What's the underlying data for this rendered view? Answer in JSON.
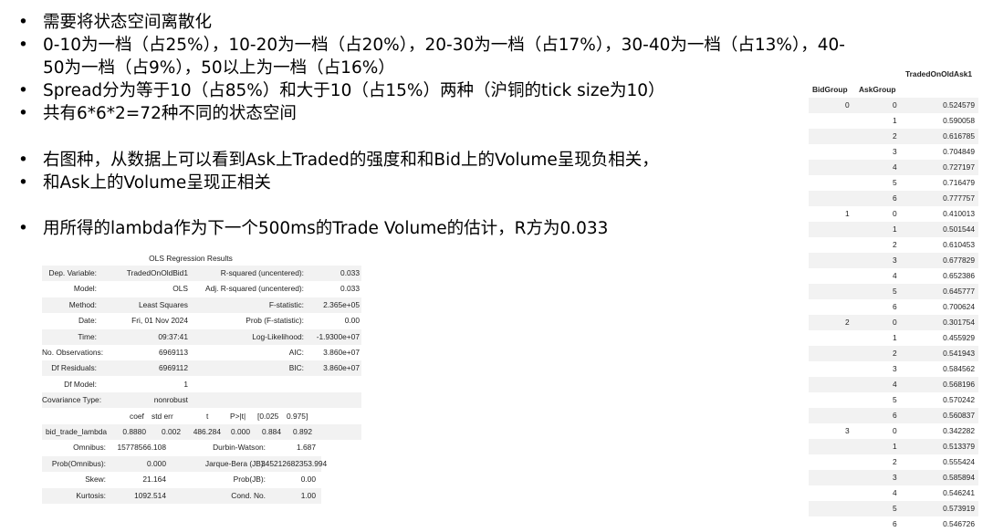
{
  "bullets": [
    {
      "text": "需要将状态空间离散化"
    },
    {
      "text": "0-10为一档（占25%），10-20为一档（占20%），20-30为一档（占17%），30-40为一档（占13%），40-",
      "cont": "50为一档（占9%），50以上为一档（占16%）"
    },
    {
      "text": "Spread分为等于10（占85%）和大于10（占15%）两种（沪铜的tick size为10）"
    },
    {
      "text": "共有6*6*2=72种不同的状态空间"
    },
    {
      "text": "右图种，从数据上可以看到Ask上Traded的强度和和Bid上的Volume呈现负相关，"
    },
    {
      "text": "和Ask上的Volume呈现正相关"
    },
    {
      "text": "用所得的lambda作为下一个500ms的Trade Volume的估计，R方为0.033"
    }
  ],
  "bullet_symbol": "•",
  "ols": {
    "caption": "OLS Regression Results",
    "summary": [
      [
        "Dep. Variable:",
        "TradedOnOldBid1",
        "R-squared (uncentered):",
        "0.033"
      ],
      [
        "Model:",
        "OLS",
        "Adj. R-squared (uncentered):",
        "0.033"
      ],
      [
        "Method:",
        "Least Squares",
        "F-statistic:",
        "2.365e+05"
      ],
      [
        "Date:",
        "Fri, 01 Nov 2024",
        "Prob (F-statistic):",
        "0.00"
      ],
      [
        "Time:",
        "09:37:41",
        "Log-Likelihood:",
        "-1.9300e+07"
      ],
      [
        "No. Observations:",
        "6969113",
        "AIC:",
        "3.860e+07"
      ],
      [
        "Df Residuals:",
        "6969112",
        "BIC:",
        "3.860e+07"
      ],
      [
        "Df Model:",
        "1",
        "",
        ""
      ],
      [
        "Covariance Type:",
        "nonrobust",
        "",
        ""
      ]
    ],
    "coef_header": [
      "coef",
      "std err",
      "t",
      "P>|t|",
      "[0.025",
      "0.975]"
    ],
    "coef_row": [
      "bid_trade_lambda",
      "0.8880",
      "0.002",
      "486.284",
      "0.000",
      "0.884",
      "0.892"
    ],
    "diag": [
      [
        "Omnibus:",
        "15778566.108",
        "Durbin-Watson:",
        "1.687"
      ],
      [
        "Prob(Omnibus):",
        "0.000",
        "Jarque-Bera (JB):",
        "345212682353.994"
      ],
      [
        "Skew:",
        "21.164",
        "Prob(JB):",
        "0.00"
      ],
      [
        "Kurtosis:",
        "1092.514",
        "Cond. No.",
        "1.00"
      ]
    ]
  },
  "grouped_table": {
    "column_header": "TradedOnOldAsk1",
    "index_headers": [
      "BidGroup",
      "AskGroup"
    ],
    "groups": [
      {
        "bid": "0",
        "rows": [
          [
            "0",
            "0.524579"
          ],
          [
            "1",
            "0.590058"
          ],
          [
            "2",
            "0.616785"
          ],
          [
            "3",
            "0.704849"
          ],
          [
            "4",
            "0.727197"
          ],
          [
            "5",
            "0.716479"
          ],
          [
            "6",
            "0.777757"
          ]
        ]
      },
      {
        "bid": "1",
        "rows": [
          [
            "0",
            "0.410013"
          ],
          [
            "1",
            "0.501544"
          ],
          [
            "2",
            "0.610453"
          ],
          [
            "3",
            "0.677829"
          ],
          [
            "4",
            "0.652386"
          ],
          [
            "5",
            "0.645777"
          ],
          [
            "6",
            "0.700624"
          ]
        ]
      },
      {
        "bid": "2",
        "rows": [
          [
            "0",
            "0.301754"
          ],
          [
            "1",
            "0.455929"
          ],
          [
            "2",
            "0.541943"
          ],
          [
            "3",
            "0.584562"
          ],
          [
            "4",
            "0.568196"
          ],
          [
            "5",
            "0.570242"
          ],
          [
            "6",
            "0.560837"
          ]
        ]
      },
      {
        "bid": "3",
        "rows": [
          [
            "0",
            "0.342282"
          ],
          [
            "1",
            "0.513379"
          ],
          [
            "2",
            "0.555424"
          ],
          [
            "3",
            "0.585894"
          ],
          [
            "4",
            "0.546241"
          ],
          [
            "5",
            "0.573919"
          ],
          [
            "6",
            "0.546726"
          ]
        ]
      }
    ]
  }
}
